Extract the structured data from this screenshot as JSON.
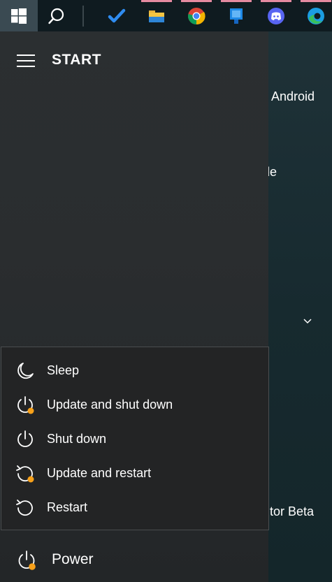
{
  "taskbar": {
    "start_icon": "windows-logo-icon",
    "search_icon": "search-icon",
    "apps": [
      {
        "name": "todo-icon"
      },
      {
        "name": "file-explorer-icon"
      },
      {
        "name": "chrome-icon"
      },
      {
        "name": "app-blue-icon"
      },
      {
        "name": "discord-icon"
      },
      {
        "name": "edge-icon"
      }
    ]
  },
  "start": {
    "title": "START"
  },
  "background": {
    "text1": "Android",
    "text2": "le",
    "text3": "tor Beta"
  },
  "power_menu": {
    "items": [
      {
        "label": "Sleep",
        "icon": "sleep-moon-icon"
      },
      {
        "label": "Update and shut down",
        "icon": "update-power-icon"
      },
      {
        "label": "Shut down",
        "icon": "power-icon"
      },
      {
        "label": "Update and restart",
        "icon": "update-restart-icon"
      },
      {
        "label": "Restart",
        "icon": "restart-icon"
      }
    ]
  },
  "power": {
    "label": "Power",
    "icon": "power-update-icon"
  },
  "colors": {
    "update_badge": "#f7a11a",
    "taskbar_bg": "#0f1b20",
    "menu_bg": "#232425"
  }
}
